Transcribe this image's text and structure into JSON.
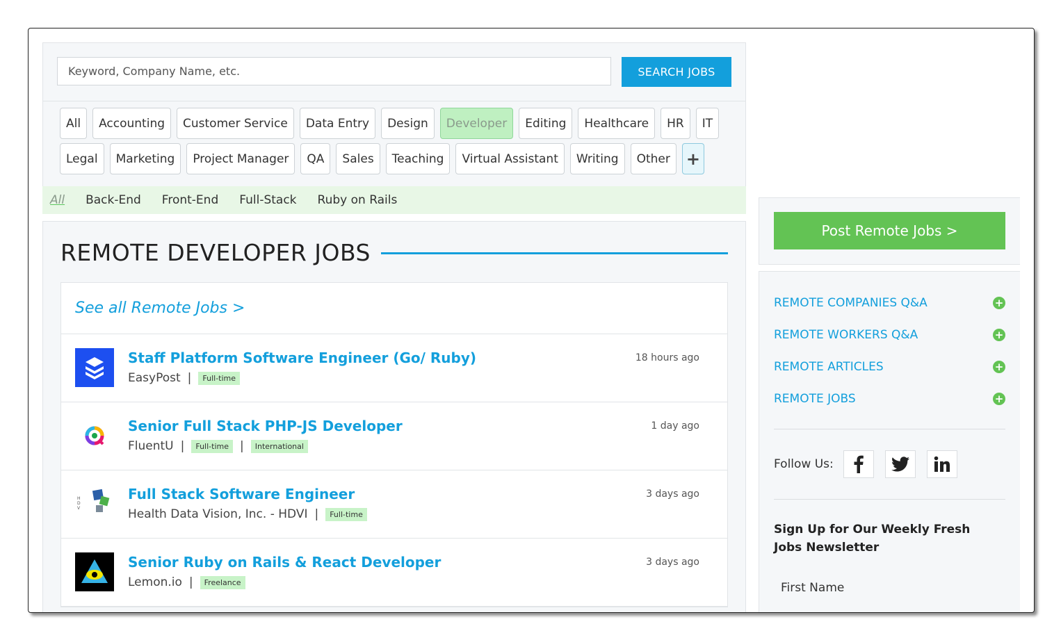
{
  "search": {
    "placeholder": "Keyword, Company Name, etc.",
    "button_label": "SEARCH JOBS"
  },
  "categories": [
    "All",
    "Accounting",
    "Customer Service",
    "Data Entry",
    "Design",
    "Developer",
    "Editing",
    "Healthcare",
    "HR",
    "IT",
    "Legal",
    "Marketing",
    "Project Manager",
    "QA",
    "Sales",
    "Teaching",
    "Virtual Assistant",
    "Writing",
    "Other",
    "+"
  ],
  "active_category": "Developer",
  "subcategories": [
    "All",
    "Back-End",
    "Front-End",
    "Full-Stack",
    "Ruby on Rails"
  ],
  "jobs_section": {
    "title": "REMOTE DEVELOPER JOBS",
    "see_all": "See all Remote Jobs >",
    "jobs": [
      {
        "title": "Staff Platform Software Engineer (Go/ Ruby)",
        "company": "EasyPost",
        "tags": [
          "Full-time"
        ],
        "time": "18 hours ago",
        "logo": "easypost-logo-icon"
      },
      {
        "title": "Senior Full Stack PHP-JS Developer",
        "company": "FluentU",
        "tags": [
          "Full-time",
          "International"
        ],
        "time": "1 day ago",
        "logo": "fluentu-logo-icon"
      },
      {
        "title": "Full Stack Software Engineer",
        "company": "Health Data Vision, Inc. - HDVI",
        "tags": [
          "Full-time"
        ],
        "time": "3 days ago",
        "logo": "hdvi-logo-icon"
      },
      {
        "title": "Senior Ruby on Rails & React Developer",
        "company": "Lemon.io",
        "tags": [
          "Freelance"
        ],
        "time": "3 days ago",
        "logo": "lemon-io-logo-icon"
      }
    ]
  },
  "sidebar": {
    "post_button": "Post Remote Jobs >",
    "links": [
      "REMOTE COMPANIES Q&A",
      "REMOTE WORKERS Q&A",
      "REMOTE ARTICLES",
      "REMOTE JOBS"
    ],
    "follow_label": "Follow Us:",
    "social": [
      "facebook-icon",
      "twitter-icon",
      "linkedin-icon"
    ],
    "newsletter_title": "Sign Up for Our Weekly Fresh Jobs Newsletter",
    "first_name_label": "First Name"
  },
  "colors": {
    "accent": "#139fdc",
    "green": "#63c354",
    "tag_bg": "#c8f3c8",
    "active_cat_bg": "#bff0c1"
  }
}
